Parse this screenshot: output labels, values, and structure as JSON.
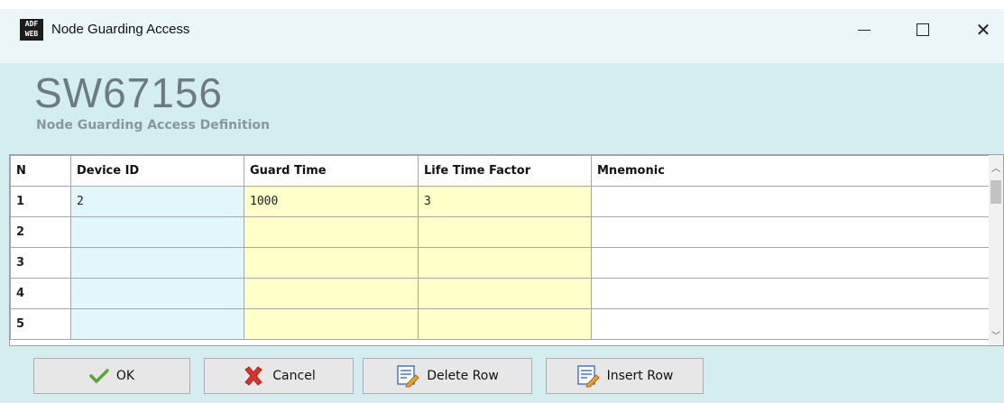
{
  "window": {
    "title": "Node Guarding Access",
    "app_icon_text": "ADF WEB"
  },
  "header": {
    "product_code": "SW67156",
    "subtitle": "Node Guarding Access Definition"
  },
  "table": {
    "columns": [
      "N",
      "Device ID",
      "Guard Time",
      "Life Time Factor",
      "Mnemonic"
    ],
    "rows": [
      {
        "n": "1",
        "device_id": "2",
        "guard_time": "1000",
        "life_time_factor": "3",
        "mnemonic": ""
      },
      {
        "n": "2",
        "device_id": "",
        "guard_time": "",
        "life_time_factor": "",
        "mnemonic": ""
      },
      {
        "n": "3",
        "device_id": "",
        "guard_time": "",
        "life_time_factor": "",
        "mnemonic": ""
      },
      {
        "n": "4",
        "device_id": "",
        "guard_time": "",
        "life_time_factor": "",
        "mnemonic": ""
      },
      {
        "n": "5",
        "device_id": "",
        "guard_time": "",
        "life_time_factor": "",
        "mnemonic": ""
      }
    ]
  },
  "buttons": {
    "ok": "OK",
    "cancel": "Cancel",
    "delete_row": "Delete Row",
    "insert_row": "Insert Row"
  },
  "colors": {
    "background": "#d4eef0",
    "device_col": "#e1f7fc",
    "guard_col": "#ffffc9"
  },
  "icons": {
    "ok": "checkmark-icon",
    "cancel": "red-x-icon",
    "delete_row": "delete-row-icon",
    "insert_row": "insert-row-icon"
  }
}
